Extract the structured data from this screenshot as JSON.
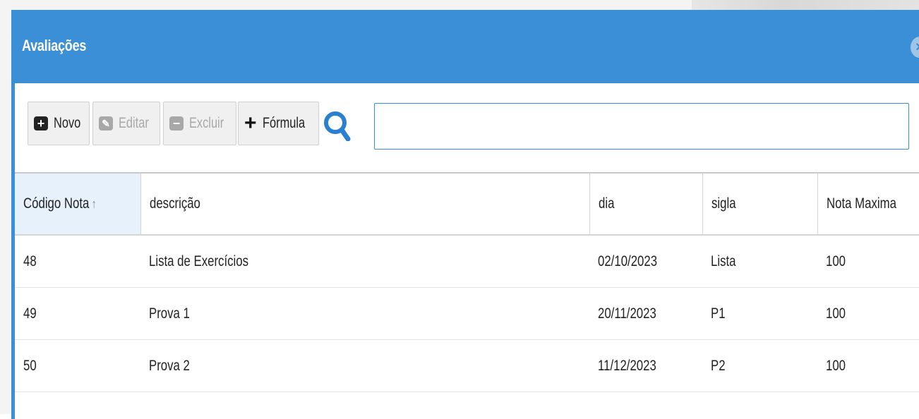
{
  "dialog": {
    "title": "Avaliações",
    "close_icon": "close-circle-icon"
  },
  "toolbar": {
    "new_label": "Novo",
    "edit_label": "Editar",
    "delete_label": "Excluir",
    "formula_label": "Fórmula",
    "search_icon": "search-icon",
    "search_value": ""
  },
  "table": {
    "columns": [
      "Código Nota",
      "descrição",
      "dia",
      "sigla",
      "Nota Maxima"
    ],
    "sort_icon": "↑",
    "rows": [
      [
        "48",
        "Lista de Exercícios",
        "02/10/2023",
        "Lista",
        "100"
      ],
      [
        "49",
        "Prova 1",
        "20/11/2023",
        "P1",
        "100"
      ],
      [
        "50",
        "Prova 2",
        "11/12/2023",
        "P2",
        "100"
      ]
    ]
  },
  "colors": {
    "accent": "#3a8fd6",
    "sorted_header_bg": "#e6f1fb"
  }
}
